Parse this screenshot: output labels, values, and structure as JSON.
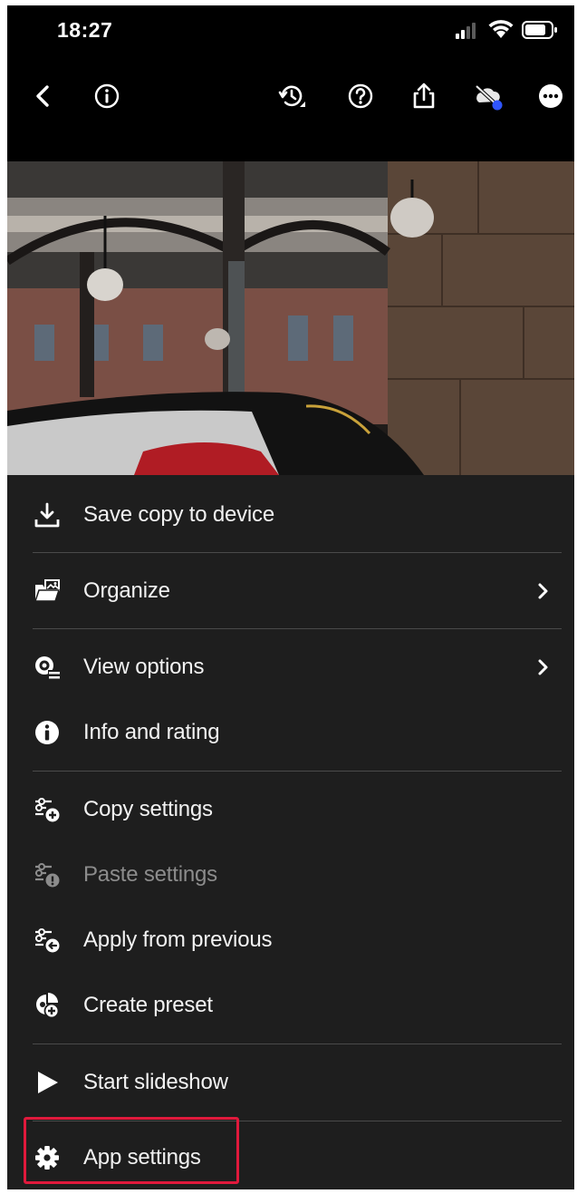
{
  "status_bar": {
    "time": "18:27"
  },
  "toolbar": {
    "icons": [
      "back-icon",
      "info-icon",
      "history-icon",
      "help-icon",
      "share-icon",
      "cloud-off-icon",
      "more-icon"
    ]
  },
  "menu": {
    "items": [
      {
        "label": "Save copy to device",
        "icon": "download-icon"
      },
      {
        "label": "Organize",
        "icon": "folder-icon"
      },
      {
        "label": "View options",
        "icon": "view-options-icon"
      },
      {
        "label": "Info and rating",
        "icon": "info-filled-icon"
      },
      {
        "label": "Copy settings",
        "icon": "copy-settings-icon"
      },
      {
        "label": "Paste settings",
        "icon": "paste-settings-icon"
      },
      {
        "label": "Apply from previous",
        "icon": "apply-previous-icon"
      },
      {
        "label": "Create preset",
        "icon": "create-preset-icon"
      },
      {
        "label": "Start slideshow",
        "icon": "play-icon"
      },
      {
        "label": "App settings",
        "icon": "gear-icon"
      }
    ]
  },
  "colors": {
    "highlight": "#e0193c",
    "menu_background": "#1e1e1e",
    "accent_dot": "#2f55ff"
  }
}
